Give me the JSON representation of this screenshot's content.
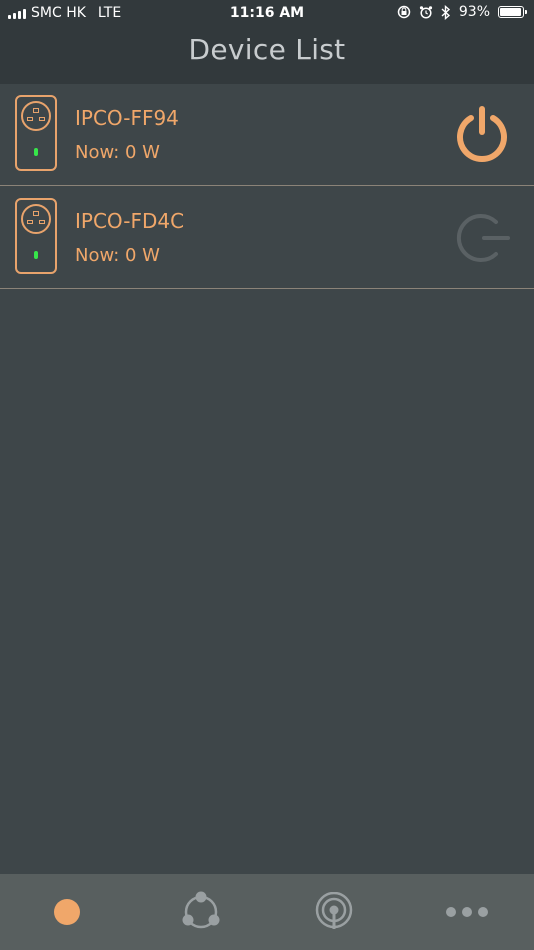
{
  "status_bar": {
    "carrier": "SMC HK",
    "network": "LTE",
    "time": "11:16 AM",
    "battery_percent": "93%"
  },
  "header": {
    "title": "Device List"
  },
  "devices": [
    {
      "name": "IPCO-FF94",
      "power": "Now: 0 W",
      "state": "on"
    },
    {
      "name": "IPCO-FD4C",
      "power": "Now: 0 W",
      "state": "off"
    }
  ],
  "tab_bar": {
    "tabs": [
      {
        "icon": "dot-icon",
        "active": true
      },
      {
        "icon": "share-network-icon",
        "active": false
      },
      {
        "icon": "broadcast-icon",
        "active": false
      },
      {
        "icon": "more-icon",
        "active": false
      }
    ]
  },
  "colors": {
    "accent": "#f0a76a",
    "background": "#3e4649",
    "header": "#32393c",
    "tab_bar": "#585f5f",
    "inactive_icon": "#9aa0a2",
    "led_green": "#37e64a"
  }
}
